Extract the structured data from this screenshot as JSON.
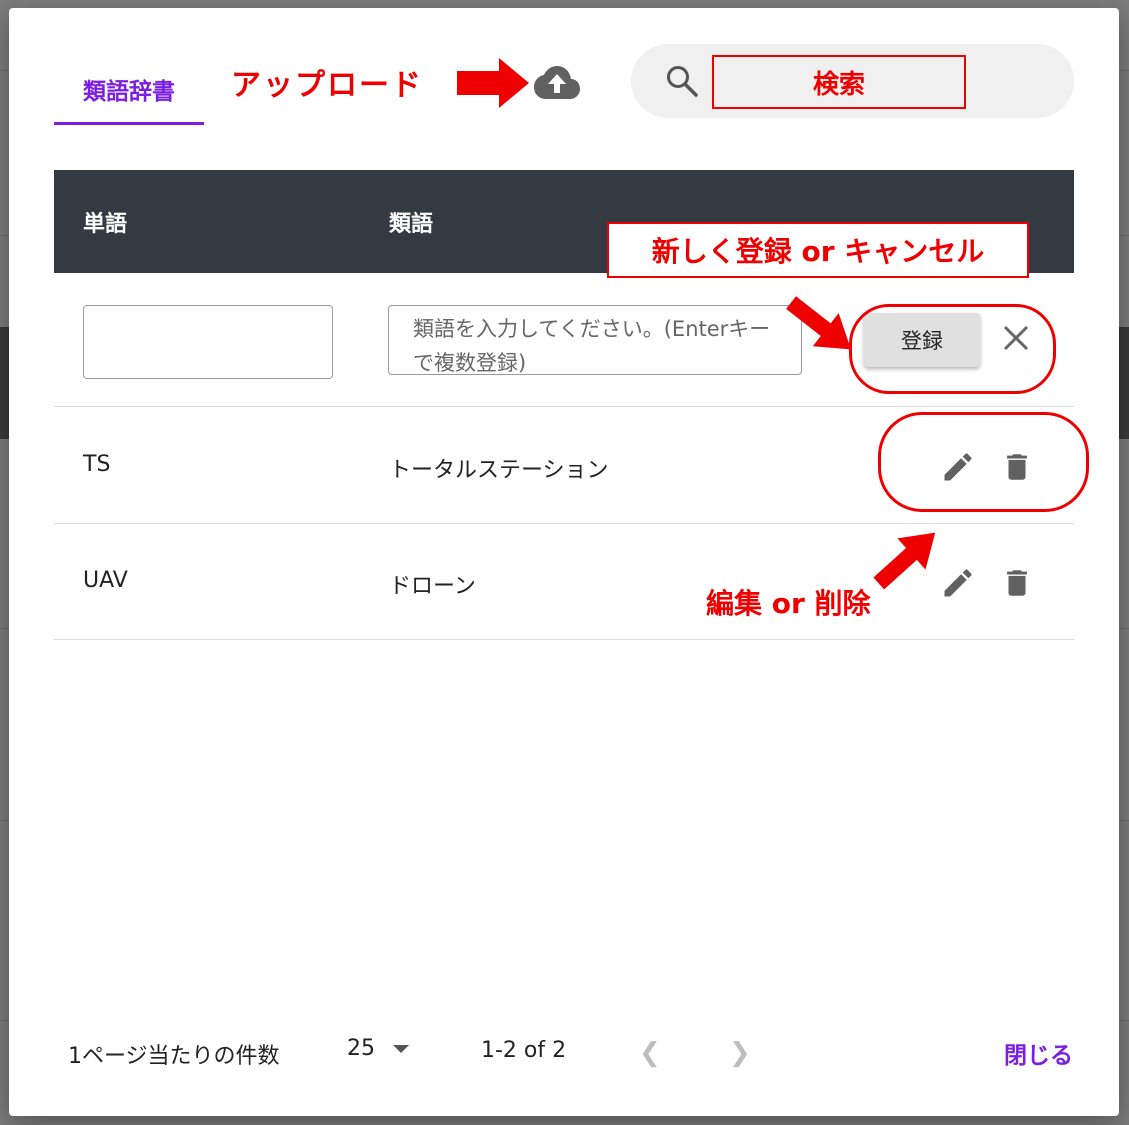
{
  "dialog": {
    "tab_label": "類語辞書",
    "search": {
      "placeholder": ""
    },
    "table": {
      "headers": {
        "word": "単語",
        "synonym": "類語"
      },
      "new_row": {
        "word_value": "",
        "synonym_placeholder": "類語を入力してください。(Enterキーで複数登録)",
        "register_label": "登録"
      },
      "rows": [
        {
          "word": "TS",
          "synonym": "トータルステーション"
        },
        {
          "word": "UAV",
          "synonym": "ドローン"
        }
      ]
    },
    "footer": {
      "rows_per_page_label": "1ページ当たりの件数",
      "rows_per_page_value": "25",
      "range": "1-2 of 2",
      "close_label": "閉じる"
    }
  },
  "annotations": {
    "upload": "アップロード",
    "search": "検索",
    "new_or_cancel": "新しく登録 or キャンセル",
    "edit_or_delete": "編集 or 削除"
  },
  "colors": {
    "accent": "#7b1fe0",
    "annotation_red": "#ef0000",
    "header_bg": "#343a42"
  },
  "icons": [
    "cloud-upload-icon",
    "search-icon",
    "close-icon",
    "pencil-icon",
    "trash-icon",
    "chevron-left-icon",
    "chevron-right-icon",
    "caret-down-icon"
  ]
}
